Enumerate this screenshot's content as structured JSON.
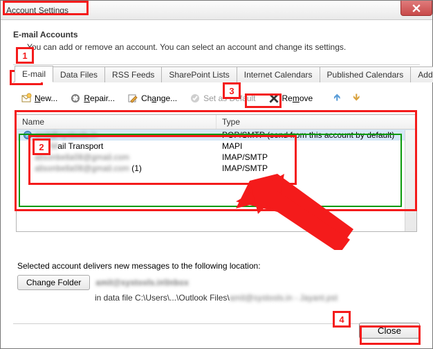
{
  "window": {
    "title": "Account Settings"
  },
  "header": {
    "heading": "E-mail Accounts",
    "subtext": "You can add or remove an account. You can select an account and change its settings."
  },
  "tabs": [
    {
      "id": "email",
      "label": "E-mail",
      "active": true
    },
    {
      "id": "datafiles",
      "label": "Data Files",
      "active": false
    },
    {
      "id": "rss",
      "label": "RSS Feeds",
      "active": false
    },
    {
      "id": "sharepoint",
      "label": "SharePoint Lists",
      "active": false
    },
    {
      "id": "intcal",
      "label": "Internet Calendars",
      "active": false
    },
    {
      "id": "pubcal",
      "label": "Published Calendars",
      "active": false
    },
    {
      "id": "addr",
      "label": "Address Books",
      "active": false
    }
  ],
  "toolbar": {
    "new": "New...",
    "repair": "Repair...",
    "change": "Change...",
    "set_default": "Set as Default",
    "remove": "Remove"
  },
  "table": {
    "col_name": "Name",
    "col_type": "Type",
    "rows": [
      {
        "name": "amit@systools.in",
        "type": "POP/SMTP (send from this account by default)",
        "default": true,
        "selected": true,
        "blur": true
      },
      {
        "name": "Fax Mail Transport",
        "type": "MAPI",
        "blur_part": "ax M"
      },
      {
        "name": "alisonbella08@gmail.com",
        "type": "IMAP/SMTP",
        "blur": true
      },
      {
        "name": "alisonbella08@gmail.com (1)",
        "type": "IMAP/SMTP",
        "blur": true
      }
    ]
  },
  "bottom": {
    "selected_text": "Selected account delivers new messages to the following location:",
    "change_folder": "Change Folder",
    "location_main": "amit@systools.in\\Inbox",
    "location_sub_prefix": "in data file C:\\Users\\...\\Outlook Files\\",
    "location_sub_blur": "amit@systools.in - Jayant.pst"
  },
  "footer": {
    "close": "Close"
  },
  "annotations": {
    "l1": "1",
    "l2": "2",
    "l3": "3",
    "l4": "4"
  }
}
